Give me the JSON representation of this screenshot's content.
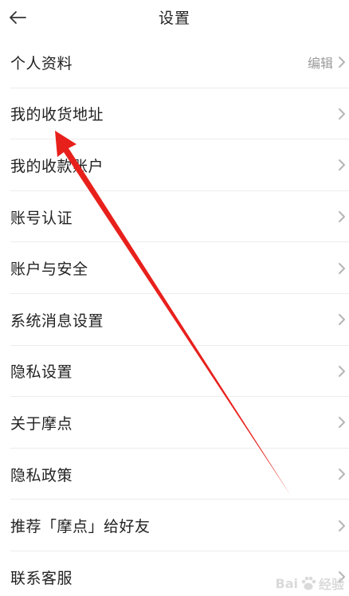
{
  "header": {
    "title": "设置"
  },
  "menu": {
    "items": [
      {
        "label": "个人资料",
        "hint": "编辑"
      },
      {
        "label": "我的收货地址"
      },
      {
        "label": "我的收款账户"
      },
      {
        "label": "账号认证"
      },
      {
        "label": "账户与安全"
      },
      {
        "label": "系统消息设置"
      },
      {
        "label": "隐私设置"
      },
      {
        "label": "关于摩点"
      },
      {
        "label": "隐私政策"
      },
      {
        "label": "推荐「摩点」给好友"
      },
      {
        "label": "联系客服"
      }
    ]
  },
  "watermark": {
    "prefix": "Bai",
    "suffix": "经验"
  },
  "icons": {
    "back": "back-arrow-icon",
    "chevron": "chevron-right-icon",
    "annotation": "red-arrow-annotation",
    "watermark": "baidu-paw-icon"
  },
  "colors": {
    "text": "#222222",
    "hint": "#9a9a9a",
    "chevron": "#b5b5b5",
    "divider": "#ececec",
    "arrow": "#e8201c"
  }
}
